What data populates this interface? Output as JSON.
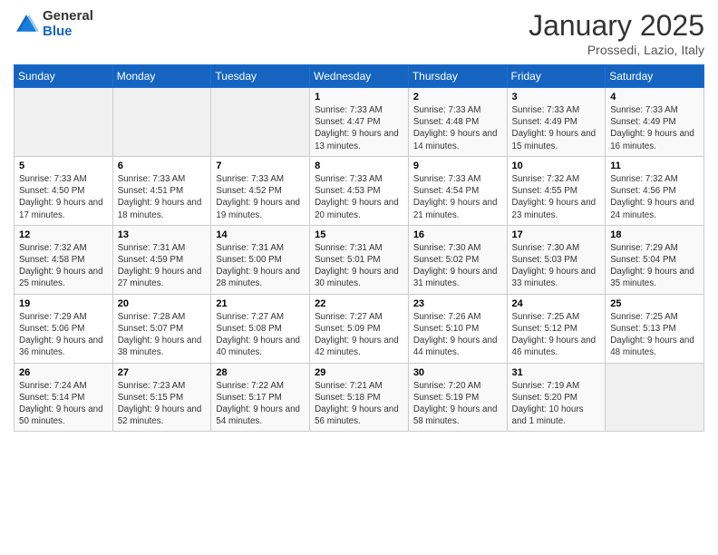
{
  "logo": {
    "general": "General",
    "blue": "Blue"
  },
  "header": {
    "month": "January 2025",
    "location": "Prossedi, Lazio, Italy"
  },
  "weekdays": [
    "Sunday",
    "Monday",
    "Tuesday",
    "Wednesday",
    "Thursday",
    "Friday",
    "Saturday"
  ],
  "weeks": [
    [
      {
        "day": "",
        "empty": true
      },
      {
        "day": "",
        "empty": true
      },
      {
        "day": "",
        "empty": true
      },
      {
        "day": "1",
        "sunrise": "7:33 AM",
        "sunset": "4:47 PM",
        "daylight": "9 hours and 13 minutes."
      },
      {
        "day": "2",
        "sunrise": "7:33 AM",
        "sunset": "4:48 PM",
        "daylight": "9 hours and 14 minutes."
      },
      {
        "day": "3",
        "sunrise": "7:33 AM",
        "sunset": "4:49 PM",
        "daylight": "9 hours and 15 minutes."
      },
      {
        "day": "4",
        "sunrise": "7:33 AM",
        "sunset": "4:49 PM",
        "daylight": "9 hours and 16 minutes."
      }
    ],
    [
      {
        "day": "5",
        "sunrise": "7:33 AM",
        "sunset": "4:50 PM",
        "daylight": "9 hours and 17 minutes."
      },
      {
        "day": "6",
        "sunrise": "7:33 AM",
        "sunset": "4:51 PM",
        "daylight": "9 hours and 18 minutes."
      },
      {
        "day": "7",
        "sunrise": "7:33 AM",
        "sunset": "4:52 PM",
        "daylight": "9 hours and 19 minutes."
      },
      {
        "day": "8",
        "sunrise": "7:33 AM",
        "sunset": "4:53 PM",
        "daylight": "9 hours and 20 minutes."
      },
      {
        "day": "9",
        "sunrise": "7:33 AM",
        "sunset": "4:54 PM",
        "daylight": "9 hours and 21 minutes."
      },
      {
        "day": "10",
        "sunrise": "7:32 AM",
        "sunset": "4:55 PM",
        "daylight": "9 hours and 23 minutes."
      },
      {
        "day": "11",
        "sunrise": "7:32 AM",
        "sunset": "4:56 PM",
        "daylight": "9 hours and 24 minutes."
      }
    ],
    [
      {
        "day": "12",
        "sunrise": "7:32 AM",
        "sunset": "4:58 PM",
        "daylight": "9 hours and 25 minutes."
      },
      {
        "day": "13",
        "sunrise": "7:31 AM",
        "sunset": "4:59 PM",
        "daylight": "9 hours and 27 minutes."
      },
      {
        "day": "14",
        "sunrise": "7:31 AM",
        "sunset": "5:00 PM",
        "daylight": "9 hours and 28 minutes."
      },
      {
        "day": "15",
        "sunrise": "7:31 AM",
        "sunset": "5:01 PM",
        "daylight": "9 hours and 30 minutes."
      },
      {
        "day": "16",
        "sunrise": "7:30 AM",
        "sunset": "5:02 PM",
        "daylight": "9 hours and 31 minutes."
      },
      {
        "day": "17",
        "sunrise": "7:30 AM",
        "sunset": "5:03 PM",
        "daylight": "9 hours and 33 minutes."
      },
      {
        "day": "18",
        "sunrise": "7:29 AM",
        "sunset": "5:04 PM",
        "daylight": "9 hours and 35 minutes."
      }
    ],
    [
      {
        "day": "19",
        "sunrise": "7:29 AM",
        "sunset": "5:06 PM",
        "daylight": "9 hours and 36 minutes."
      },
      {
        "day": "20",
        "sunrise": "7:28 AM",
        "sunset": "5:07 PM",
        "daylight": "9 hours and 38 minutes."
      },
      {
        "day": "21",
        "sunrise": "7:27 AM",
        "sunset": "5:08 PM",
        "daylight": "9 hours and 40 minutes."
      },
      {
        "day": "22",
        "sunrise": "7:27 AM",
        "sunset": "5:09 PM",
        "daylight": "9 hours and 42 minutes."
      },
      {
        "day": "23",
        "sunrise": "7:26 AM",
        "sunset": "5:10 PM",
        "daylight": "9 hours and 44 minutes."
      },
      {
        "day": "24",
        "sunrise": "7:25 AM",
        "sunset": "5:12 PM",
        "daylight": "9 hours and 46 minutes."
      },
      {
        "day": "25",
        "sunrise": "7:25 AM",
        "sunset": "5:13 PM",
        "daylight": "9 hours and 48 minutes."
      }
    ],
    [
      {
        "day": "26",
        "sunrise": "7:24 AM",
        "sunset": "5:14 PM",
        "daylight": "9 hours and 50 minutes."
      },
      {
        "day": "27",
        "sunrise": "7:23 AM",
        "sunset": "5:15 PM",
        "daylight": "9 hours and 52 minutes."
      },
      {
        "day": "28",
        "sunrise": "7:22 AM",
        "sunset": "5:17 PM",
        "daylight": "9 hours and 54 minutes."
      },
      {
        "day": "29",
        "sunrise": "7:21 AM",
        "sunset": "5:18 PM",
        "daylight": "9 hours and 56 minutes."
      },
      {
        "day": "30",
        "sunrise": "7:20 AM",
        "sunset": "5:19 PM",
        "daylight": "9 hours and 58 minutes."
      },
      {
        "day": "31",
        "sunrise": "7:19 AM",
        "sunset": "5:20 PM",
        "daylight": "10 hours and 1 minute."
      },
      {
        "day": "",
        "empty": true
      }
    ]
  ],
  "labels": {
    "sunrise": "Sunrise:",
    "sunset": "Sunset:",
    "daylight": "Daylight hours"
  }
}
